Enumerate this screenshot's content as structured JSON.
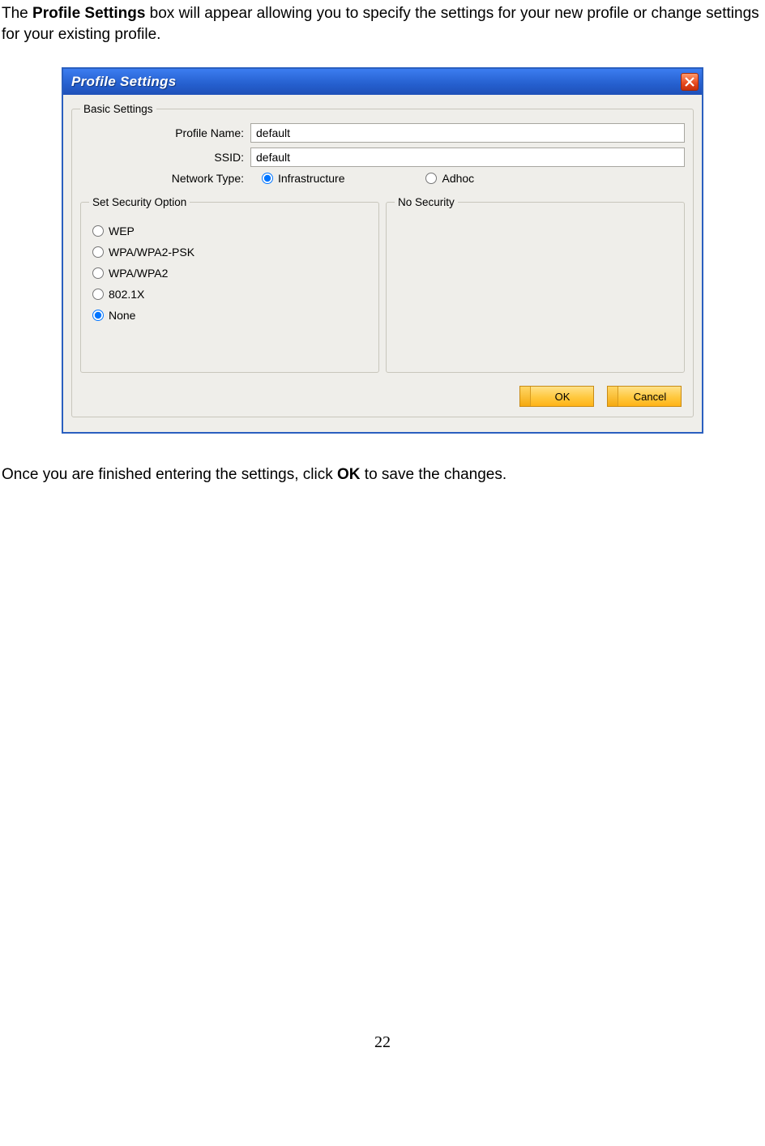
{
  "intro": {
    "pre": "The ",
    "bold": "Profile Settings",
    "post": " box will appear allowing you to specify the settings for your new profile or change settings for your existing profile."
  },
  "dialog": {
    "title": "Profile Settings",
    "basic": {
      "legend": "Basic Settings",
      "profile_name_label": "Profile Name:",
      "profile_name_value": "default",
      "ssid_label": "SSID:",
      "ssid_value": "default",
      "network_type_label": "Network Type:",
      "network_type_options": {
        "infrastructure": "Infrastructure",
        "adhoc": "Adhoc"
      },
      "network_type_selected": "infrastructure"
    },
    "security": {
      "legend": "Set Security Option",
      "options": {
        "wep": "WEP",
        "wpapsk": "WPA/WPA2-PSK",
        "wpa": "WPA/WPA2",
        "dot1x": "802.1X",
        "none": "None"
      },
      "selected": "none"
    },
    "no_security": {
      "legend": "No Security"
    },
    "buttons": {
      "ok": "OK",
      "cancel": "Cancel"
    }
  },
  "outro": {
    "pre": "Once you are finished entering the settings, click ",
    "bold": "OK",
    "post": " to save the changes."
  },
  "page_number": "22"
}
